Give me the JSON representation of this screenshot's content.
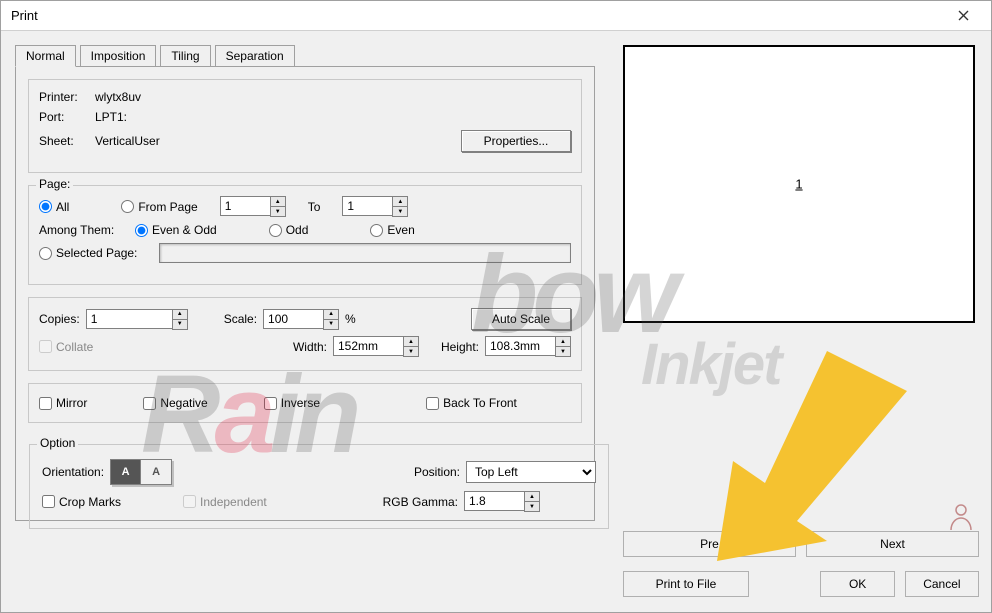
{
  "window": {
    "title": "Print"
  },
  "tabs": {
    "normal": "Normal",
    "imposition": "Imposition",
    "tiling": "Tiling",
    "separation": "Separation"
  },
  "printer": {
    "printer_label": "Printer:",
    "printer_value": "wlytx8uv",
    "port_label": "Port:",
    "port_value": "LPT1:",
    "sheet_label": "Sheet:",
    "sheet_value": "VerticalUser",
    "properties_btn": "Properties..."
  },
  "page": {
    "legend": "Page:",
    "all": "All",
    "from_page": "From Page",
    "from_value": "1",
    "to_label": "To",
    "to_value": "1",
    "among_label": "Among Them:",
    "even_odd": "Even & Odd",
    "odd": "Odd",
    "even": "Even",
    "selected_page": "Selected Page:",
    "selected_value": ""
  },
  "copies": {
    "copies_label": "Copies:",
    "copies_value": "1",
    "scale_label": "Scale:",
    "scale_value": "100",
    "percent": "%",
    "autoscale_btn": "Auto Scale",
    "collate": "Collate",
    "width_label": "Width:",
    "width_value": "152mm",
    "height_label": "Height:",
    "height_value": "108.3mm"
  },
  "flags": {
    "mirror": "Mirror",
    "negative": "Negative",
    "inverse": "Inverse",
    "back_to_front": "Back To Front"
  },
  "option": {
    "legend": "Option",
    "orientation_label": "Orientation:",
    "position_label": "Position:",
    "position_value": "Top Left",
    "crop_marks": "Crop Marks",
    "independent": "Independent",
    "rgb_gamma_label": "RGB Gamma:",
    "rgb_gamma_value": "1.8"
  },
  "preview": {
    "page_label": "1"
  },
  "nav": {
    "pre": "Pre",
    "next": "Next"
  },
  "actions": {
    "print_to_file": "Print to File",
    "ok": "OK",
    "cancel": "Cancel"
  },
  "watermark": {
    "rain_r": "R",
    "rain_a": "a",
    "rain_i": "i",
    "rain_n": "n",
    "bow": "bow",
    "inkjet": "Inkjet"
  }
}
